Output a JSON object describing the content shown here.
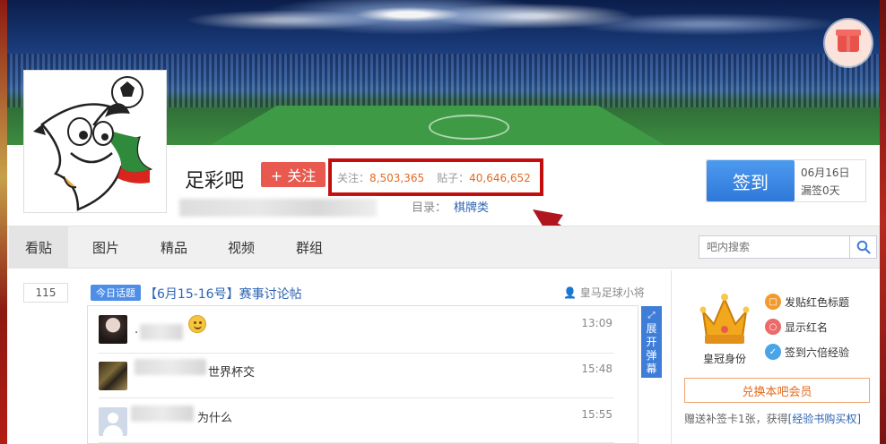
{
  "forum": {
    "name": "足彩吧",
    "follow_label": "+ 关注",
    "follow_count_label": "关注：",
    "follow_count": "8,503,365",
    "post_count_label": "贴子：",
    "post_count": "40,646,652",
    "directory_label": "目录：",
    "directory_value": "棋牌类"
  },
  "signin": {
    "button_label": "签到",
    "date": "06月16日",
    "missed": "漏签0天"
  },
  "nav": {
    "items": [
      "看贴",
      "图片",
      "精品",
      "视频",
      "群组"
    ],
    "active": "看贴",
    "search_placeholder": "吧内搜索"
  },
  "topic": {
    "reply_count": "115",
    "tag": "今日话题",
    "title": "【6月15-16号】赛事讨论帖",
    "author": "皇马足球小将"
  },
  "danmu": {
    "rows": [
      {
        "text": ".",
        "time": "13:09"
      },
      {
        "text": "世界杯交",
        "time": "15:48"
      },
      {
        "text": "为什么",
        "time": "15:55"
      }
    ],
    "expand_label": "展开弹幕"
  },
  "vip": {
    "identity_label": "皇冠身份",
    "perks": [
      "发贴红色标题",
      "显示红名",
      "签到六倍经验"
    ],
    "exchange_label": "兑换本吧会员",
    "bonus_text": "赠送补签卡1张，获得",
    "bonus_link": "[经验书购买权]"
  },
  "colors": {
    "accent_blue": "#2f78d8",
    "follow_red": "#e85a4f",
    "highlight_box": "#c40e0e",
    "stat_orange": "#e06b25",
    "link_blue": "#2d64b3"
  }
}
